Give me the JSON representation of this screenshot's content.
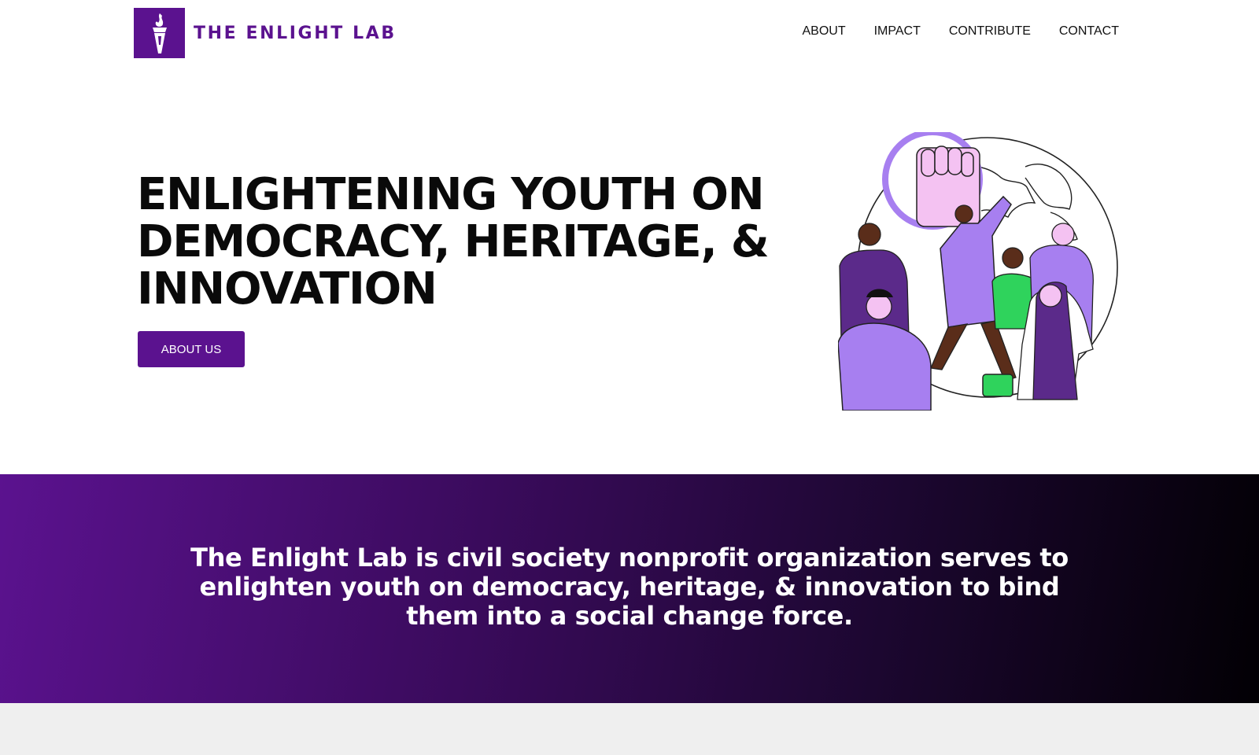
{
  "header": {
    "brand": "THE ENLIGHT LAB",
    "nav": [
      {
        "label": "ABOUT"
      },
      {
        "label": "IMPACT"
      },
      {
        "label": "CONTRIBUTE"
      },
      {
        "label": "CONTACT"
      }
    ]
  },
  "hero": {
    "title": "ENLIGHTENING YOUTH ON DEMOCRACY, HERITAGE, & INNOVATION",
    "button_label": "ABOUT US"
  },
  "mission": {
    "text": "The Enlight Lab is civil society nonprofit organization serves to enlighten youth on democracy, heritage, & innovation to bind them into a social change force."
  },
  "colors": {
    "brand_purple": "#5b128f",
    "illustration_lavender": "#a77ff0",
    "illustration_pink": "#f4c2f2",
    "illustration_green": "#2fd35c"
  },
  "icons": {
    "logo": "torch-icon",
    "illustration": "protest-crowd-globe-illustration"
  }
}
